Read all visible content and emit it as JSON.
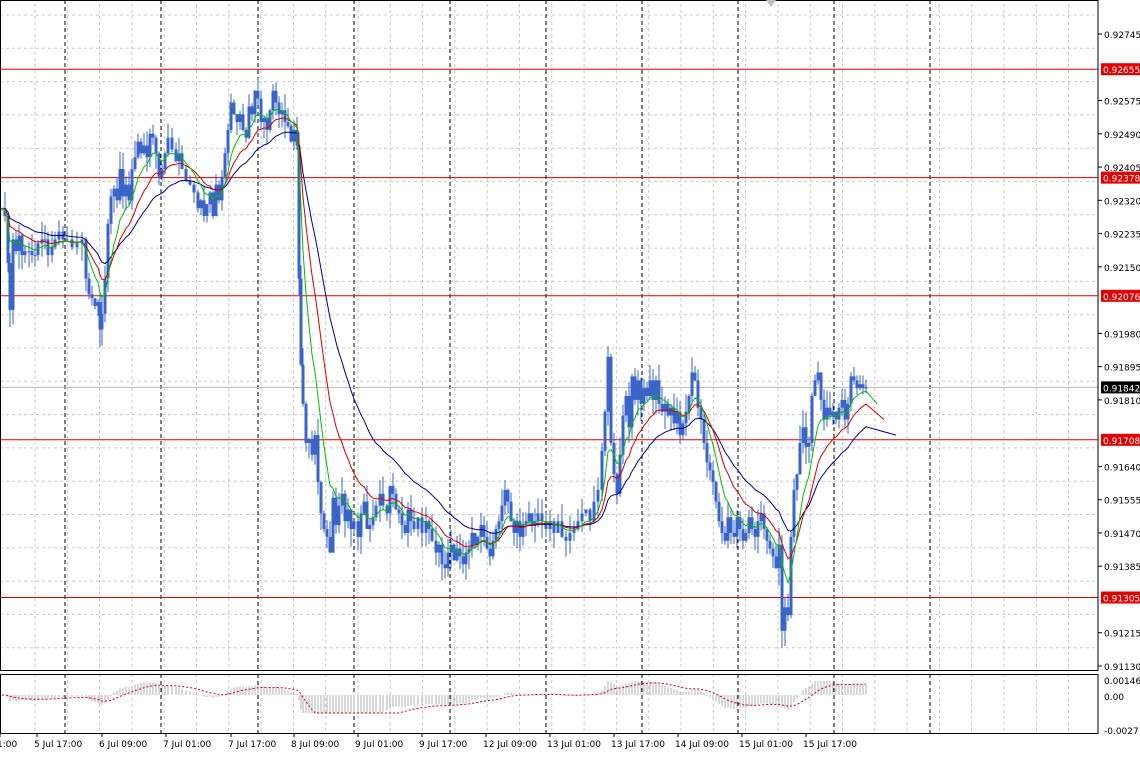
{
  "chart_data": {
    "type": "candlestick",
    "instrument_chart": "price with moving averages and oscillator subwindow",
    "colors": {
      "background": "#ffffff",
      "candle": "#3a64c8",
      "ma_fast": "#00c000",
      "ma_mid": "#d40000",
      "ma_slow": "#00008b",
      "level_line": "#e00000",
      "level_label_bg": "#e00000",
      "current_label_bg": "#000000",
      "grid": "#c8c8c8",
      "osc_bar": "#b0b0b0",
      "osc_signal": "#d40000"
    },
    "y_axis": {
      "ylim": [
        0.9113,
        0.9281
      ],
      "tick_labels": [
        "0.92745",
        "0.92655",
        "0.92575",
        "0.92490",
        "0.92405",
        "0.92378",
        "0.92320",
        "0.92235",
        "0.92150",
        "0.92076",
        "0.91980",
        "0.91895",
        "0.91842",
        "0.91810",
        "0.91708",
        "0.91640",
        "0.91555",
        "0.91470",
        "0.91385",
        "0.91305",
        "0.91215",
        "0.91130"
      ]
    },
    "x_axis": {
      "tick_labels": [
        "1:00",
        "5 Jul 17:00",
        "6 Jul 09:00",
        "7 Jul 01:00",
        "7 Jul 17:00",
        "8 Jul 09:00",
        "9 Jul 01:00",
        "9 Jul 17:00",
        "12 Jul 09:00",
        "13 Jul 01:00",
        "13 Jul 17:00",
        "14 Jul 09:00",
        "15 Jul 01:00",
        "15 Jul 17:00"
      ]
    },
    "horizontal_levels": [
      "0.92655",
      "0.92378",
      "0.92076",
      "0.91708",
      "0.91305"
    ],
    "current_price": "0.91842",
    "oscillator": {
      "tick_labels": [
        "0.00146",
        "0.00",
        "-0.0027"
      ],
      "ylim": [
        -0.0027,
        0.00146
      ]
    },
    "close_path": [
      [
        0,
        0.923
      ],
      [
        3,
        0.9228
      ],
      [
        6,
        0.9216
      ],
      [
        8,
        0.9204
      ],
      [
        11,
        0.9222
      ],
      [
        14,
        0.9219
      ],
      [
        17,
        0.9223
      ],
      [
        20,
        0.9218
      ],
      [
        23,
        0.9219
      ],
      [
        27,
        0.9219
      ],
      [
        30,
        0.9218
      ],
      [
        33,
        0.9218
      ],
      [
        36,
        0.9221
      ],
      [
        40,
        0.9222
      ],
      [
        43,
        0.9222
      ],
      [
        46,
        0.9218
      ],
      [
        50,
        0.922
      ],
      [
        53,
        0.9222
      ],
      [
        57,
        0.9224
      ],
      [
        61,
        0.9222
      ],
      [
        65,
        0.9222
      ],
      [
        70,
        0.922
      ],
      [
        75,
        0.9221
      ],
      [
        80,
        0.9222
      ],
      [
        84,
        0.9212
      ],
      [
        87,
        0.9208
      ],
      [
        90,
        0.9207
      ],
      [
        93,
        0.9205
      ],
      [
        96,
        0.9206
      ],
      [
        98,
        0.9199
      ],
      [
        100,
        0.9203
      ],
      [
        103,
        0.9212
      ],
      [
        106,
        0.9226
      ],
      [
        109,
        0.9233
      ],
      [
        112,
        0.9235
      ],
      [
        115,
        0.9232
      ],
      [
        118,
        0.924
      ],
      [
        121,
        0.9233
      ],
      [
        124,
        0.9236
      ],
      [
        127,
        0.9232
      ],
      [
        130,
        0.924
      ],
      [
        133,
        0.9243
      ],
      [
        136,
        0.9247
      ],
      [
        139,
        0.9244
      ],
      [
        142,
        0.9246
      ],
      [
        145,
        0.9243
      ],
      [
        148,
        0.9249
      ],
      [
        151,
        0.9248
      ],
      [
        154,
        0.9244
      ],
      [
        157,
        0.9238
      ],
      [
        160,
        0.924
      ],
      [
        163,
        0.9244
      ],
      [
        166,
        0.9248
      ],
      [
        170,
        0.9245
      ],
      [
        174,
        0.9242
      ],
      [
        177,
        0.9244
      ],
      [
        180,
        0.924
      ],
      [
        184,
        0.9237
      ],
      [
        188,
        0.9236
      ],
      [
        192,
        0.9234
      ],
      [
        196,
        0.923
      ],
      [
        199,
        0.9232
      ],
      [
        202,
        0.9228
      ],
      [
        205,
        0.9231
      ],
      [
        208,
        0.9234
      ],
      [
        211,
        0.9228
      ],
      [
        214,
        0.9236
      ],
      [
        217,
        0.9232
      ],
      [
        220,
        0.9238
      ],
      [
        223,
        0.9244
      ],
      [
        226,
        0.925
      ],
      [
        229,
        0.9257
      ],
      [
        232,
        0.9254
      ],
      [
        235,
        0.9252
      ],
      [
        238,
        0.9254
      ],
      [
        241,
        0.925
      ],
      [
        244,
        0.9248
      ],
      [
        247,
        0.9256
      ],
      [
        250,
        0.9254
      ],
      [
        253,
        0.926
      ],
      [
        256,
        0.9258
      ],
      [
        259,
        0.9252
      ],
      [
        262,
        0.9253
      ],
      [
        265,
        0.925
      ],
      [
        268,
        0.9255
      ],
      [
        271,
        0.926
      ],
      [
        274,
        0.9257
      ],
      [
        277,
        0.9254
      ],
      [
        280,
        0.9255
      ],
      [
        283,
        0.9252
      ],
      [
        286,
        0.9251
      ],
      [
        289,
        0.9247
      ],
      [
        292,
        0.925
      ],
      [
        295,
        0.9246
      ],
      [
        297,
        0.9212
      ],
      [
        299,
        0.919
      ],
      [
        301,
        0.918
      ],
      [
        304,
        0.917
      ],
      [
        307,
        0.9171
      ],
      [
        310,
        0.9167
      ],
      [
        313,
        0.9172
      ],
      [
        316,
        0.916
      ],
      [
        319,
        0.9152
      ],
      [
        322,
        0.9148
      ],
      [
        325,
        0.9146
      ],
      [
        328,
        0.9142
      ],
      [
        331,
        0.9156
      ],
      [
        334,
        0.9149
      ],
      [
        337,
        0.9154
      ],
      [
        340,
        0.9157
      ],
      [
        343,
        0.915
      ],
      [
        346,
        0.9153
      ],
      [
        349,
        0.9148
      ],
      [
        352,
        0.915
      ],
      [
        356,
        0.9146
      ],
      [
        359,
        0.9152
      ],
      [
        362,
        0.9155
      ],
      [
        365,
        0.9148
      ],
      [
        368,
        0.9149
      ],
      [
        371,
        0.9151
      ],
      [
        374,
        0.9154
      ],
      [
        378,
        0.9157
      ],
      [
        381,
        0.9154
      ],
      [
        385,
        0.9152
      ],
      [
        388,
        0.9159
      ],
      [
        391,
        0.9157
      ],
      [
        394,
        0.9153
      ],
      [
        397,
        0.9152
      ],
      [
        400,
        0.9149
      ],
      [
        403,
        0.9147
      ],
      [
        406,
        0.9153
      ],
      [
        409,
        0.915
      ],
      [
        412,
        0.9148
      ],
      [
        416,
        0.9151
      ],
      [
        420,
        0.9147
      ],
      [
        424,
        0.915
      ],
      [
        427,
        0.9148
      ],
      [
        430,
        0.9145
      ],
      [
        434,
        0.9142
      ],
      [
        437,
        0.9144
      ],
      [
        440,
        0.9139
      ],
      [
        443,
        0.9138
      ],
      [
        446,
        0.9142
      ],
      [
        449,
        0.9144
      ],
      [
        452,
        0.914
      ],
      [
        455,
        0.9143
      ],
      [
        458,
        0.9141
      ],
      [
        461,
        0.9139
      ],
      [
        464,
        0.9142
      ],
      [
        467,
        0.9143
      ],
      [
        470,
        0.9147
      ],
      [
        473,
        0.9144
      ],
      [
        476,
        0.9146
      ],
      [
        479,
        0.9149
      ],
      [
        482,
        0.9146
      ],
      [
        485,
        0.9143
      ],
      [
        488,
        0.9141
      ],
      [
        491,
        0.9145
      ],
      [
        494,
        0.9148
      ],
      [
        497,
        0.915
      ],
      [
        500,
        0.9154
      ],
      [
        503,
        0.9158
      ],
      [
        506,
        0.9155
      ],
      [
        509,
        0.915
      ],
      [
        512,
        0.9147
      ],
      [
        515,
        0.915
      ],
      [
        518,
        0.9146
      ],
      [
        521,
        0.9149
      ],
      [
        524,
        0.915
      ],
      [
        527,
        0.9152
      ],
      [
        530,
        0.9149
      ],
      [
        533,
        0.915
      ],
      [
        536,
        0.9152
      ],
      [
        540,
        0.915
      ],
      [
        544,
        0.9148
      ],
      [
        548,
        0.915
      ],
      [
        552,
        0.9147
      ],
      [
        556,
        0.915
      ],
      [
        560,
        0.9146
      ],
      [
        564,
        0.9145
      ],
      [
        568,
        0.9147
      ],
      [
        572,
        0.9148
      ],
      [
        576,
        0.915
      ],
      [
        580,
        0.9152
      ],
      [
        584,
        0.9153
      ],
      [
        588,
        0.915
      ],
      [
        592,
        0.9155
      ],
      [
        596,
        0.9158
      ],
      [
        600,
        0.9168
      ],
      [
        603,
        0.9178
      ],
      [
        606,
        0.9192
      ],
      [
        609,
        0.917
      ],
      [
        612,
        0.9162
      ],
      [
        615,
        0.9157
      ],
      [
        618,
        0.9167
      ],
      [
        621,
        0.9177
      ],
      [
        624,
        0.9182
      ],
      [
        627,
        0.9174
      ],
      [
        630,
        0.9187
      ],
      [
        633,
        0.9181
      ],
      [
        636,
        0.9186
      ],
      [
        639,
        0.918
      ],
      [
        642,
        0.9184
      ],
      [
        645,
        0.9182
      ],
      [
        648,
        0.9186
      ],
      [
        651,
        0.9181
      ],
      [
        654,
        0.9186
      ],
      [
        657,
        0.918
      ],
      [
        660,
        0.9178
      ],
      [
        663,
        0.918
      ],
      [
        666,
        0.9177
      ],
      [
        669,
        0.9179
      ],
      [
        672,
        0.9175
      ],
      [
        675,
        0.9178
      ],
      [
        678,
        0.9172
      ],
      [
        681,
        0.9175
      ],
      [
        684,
        0.9178
      ],
      [
        687,
        0.9182
      ],
      [
        690,
        0.9188
      ],
      [
        693,
        0.9186
      ],
      [
        696,
        0.9179
      ],
      [
        699,
        0.9176
      ],
      [
        702,
        0.917
      ],
      [
        705,
        0.9165
      ],
      [
        708,
        0.9163
      ],
      [
        711,
        0.916
      ],
      [
        714,
        0.9155
      ],
      [
        717,
        0.915
      ],
      [
        720,
        0.9147
      ],
      [
        723,
        0.9145
      ],
      [
        726,
        0.9151
      ],
      [
        729,
        0.9147
      ],
      [
        732,
        0.9146
      ],
      [
        735,
        0.9151
      ],
      [
        738,
        0.9148
      ],
      [
        741,
        0.9145
      ],
      [
        744,
        0.9147
      ],
      [
        747,
        0.9151
      ],
      [
        750,
        0.9148
      ],
      [
        753,
        0.9146
      ],
      [
        756,
        0.915
      ],
      [
        759,
        0.9152
      ],
      [
        762,
        0.9148
      ],
      [
        765,
        0.9145
      ],
      [
        768,
        0.9143
      ],
      [
        771,
        0.9141
      ],
      [
        774,
        0.9138
      ],
      [
        777,
        0.9144
      ],
      [
        780,
        0.9122
      ],
      [
        783,
        0.9128
      ],
      [
        786,
        0.9126
      ],
      [
        789,
        0.9146
      ],
      [
        792,
        0.9158
      ],
      [
        795,
        0.9162
      ],
      [
        798,
        0.917
      ],
      [
        801,
        0.9174
      ],
      [
        804,
        0.9169
      ],
      [
        807,
        0.917
      ],
      [
        810,
        0.9182
      ],
      [
        813,
        0.9186
      ],
      [
        816,
        0.9188
      ],
      [
        819,
        0.9181
      ],
      [
        822,
        0.9176
      ],
      [
        825,
        0.9179
      ],
      [
        828,
        0.9177
      ],
      [
        831,
        0.9178
      ],
      [
        834,
        0.9176
      ],
      [
        837,
        0.9179
      ],
      [
        840,
        0.9181
      ],
      [
        843,
        0.9176
      ],
      [
        846,
        0.918
      ],
      [
        849,
        0.9187
      ],
      [
        852,
        0.9186
      ],
      [
        855,
        0.9184
      ],
      [
        858,
        0.9185
      ],
      [
        861,
        0.9184
      ],
      [
        864,
        0.91842
      ]
    ]
  }
}
